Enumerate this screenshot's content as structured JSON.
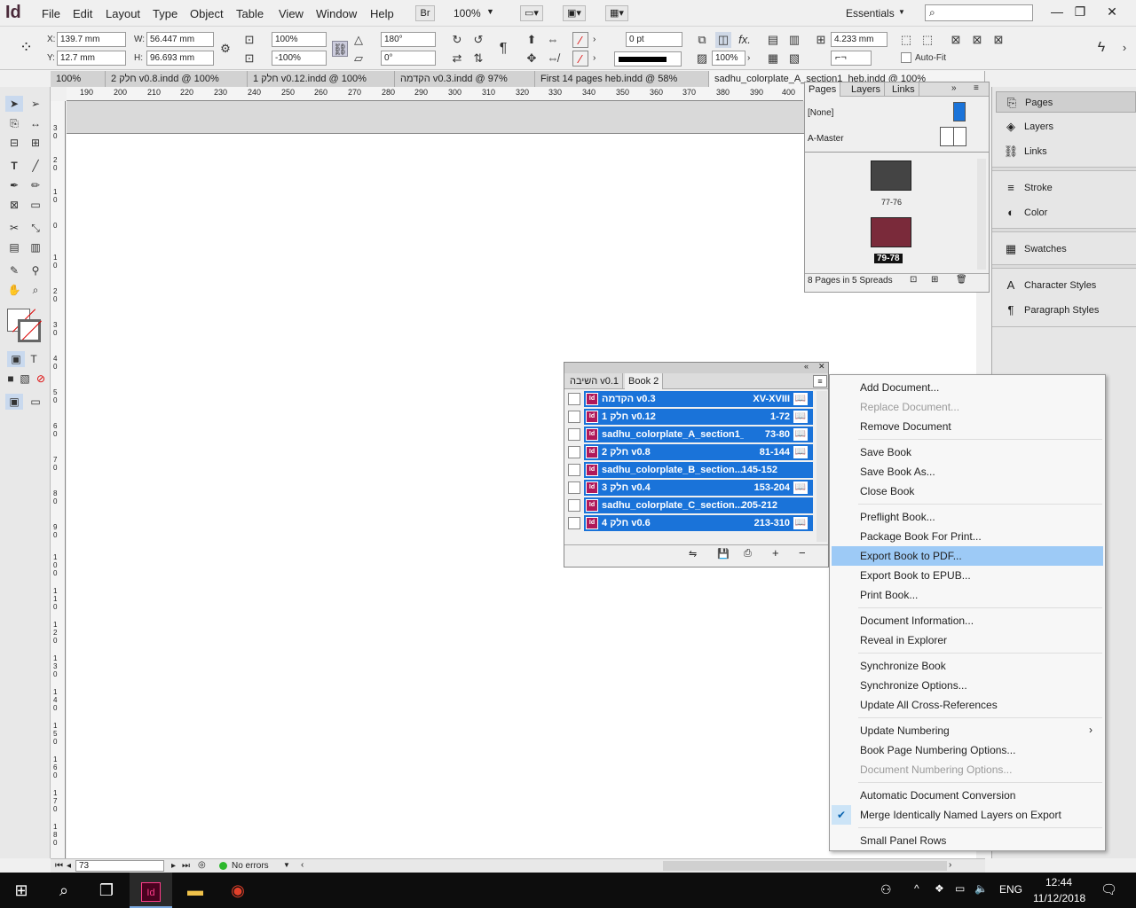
{
  "app": {
    "logo": "Id",
    "menus": [
      "File",
      "Edit",
      "Layout",
      "Type",
      "Object",
      "Table",
      "View",
      "Window",
      "Help"
    ],
    "bridge_label": "Br",
    "zoom": "100%",
    "workspace": "Essentials",
    "search_placeholder": ""
  },
  "control": {
    "x_label": "X:",
    "x_value": "139.7 mm",
    "y_label": "Y:",
    "y_value": "12.7 mm",
    "w_label": "W:",
    "w_value": "56.447 mm",
    "h_label": "H:",
    "h_value": "96.693 mm",
    "scale_x": "100%",
    "scale_y": "-100%",
    "rotate": "180°",
    "shear": "0°",
    "stroke_weight": "0 pt",
    "opacity": "100%",
    "dimension": "4.233 mm",
    "auto_fit": "Auto-Fit"
  },
  "tabs": [
    {
      "label": "100%"
    },
    {
      "label": "2 חלק v0.8.indd @ 100%"
    },
    {
      "label": "1 חלק v0.12.indd @ 100%"
    },
    {
      "label": "הקדמה v0.3.indd @ 97%"
    },
    {
      "label": "First 14 pages heb.indd @ 58%"
    },
    {
      "label": "sadhu_colorplate_A_section1_heb.indd @ 100%"
    }
  ],
  "ruler": {
    "h_ticks": [
      "190",
      "200",
      "210",
      "220",
      "230",
      "240",
      "250",
      "260",
      "270",
      "280",
      "290",
      "300",
      "310",
      "320",
      "330",
      "340",
      "350",
      "360",
      "370",
      "380",
      "390",
      "400"
    ],
    "v_ticks": [
      "3 0",
      "2 0",
      "1 0",
      "0",
      "1 0",
      "2 0",
      "3 0",
      "4 0",
      "5 0",
      "6 0",
      "7 0",
      "8 0",
      "9 0",
      "1 0 0",
      "1 1 0",
      "1 2 0",
      "1 3 0",
      "1 4 0",
      "1 5 0",
      "1 6 0",
      "1 7 0",
      "1 8 0"
    ]
  },
  "pages_panel": {
    "tabs": [
      "Pages",
      "Layers",
      "Links"
    ],
    "none_label": "[None]",
    "master_label": "A-Master",
    "spread1": "77-76",
    "spread2": "79-78",
    "status": "8 Pages in 5 Spreads"
  },
  "dock": {
    "items": [
      "Pages",
      "Layers",
      "Links",
      "Stroke",
      "Color",
      "Swatches",
      "Character Styles",
      "Paragraph Styles"
    ]
  },
  "book_panel": {
    "tab_inactive": "השיבה v0.1",
    "tab_active": "Book 2",
    "rows": [
      {
        "name": "הקדמה v0.3",
        "pages": "XV-XVIII"
      },
      {
        "name": "1 חלק v0.12",
        "pages": "1-72"
      },
      {
        "name": "sadhu_colorplate_A_section1_...",
        "pages": "73-80"
      },
      {
        "name": "2 חלק v0.8",
        "pages": "81-144"
      },
      {
        "name": "sadhu_colorplate_B_section...",
        "pages": "145-152"
      },
      {
        "name": "3 חלק v0.4",
        "pages": "153-204"
      },
      {
        "name": "sadhu_colorplate_C_section...",
        "pages": "205-212"
      },
      {
        "name": "4 חלק v0.6",
        "pages": "213-310"
      }
    ]
  },
  "menu": {
    "add_document": "Add Document...",
    "replace_document": "Replace Document...",
    "remove_document": "Remove Document",
    "save_book": "Save Book",
    "save_book_as": "Save Book As...",
    "close_book": "Close Book",
    "preflight_book": "Preflight Book...",
    "package_book": "Package Book For Print...",
    "export_pdf": "Export Book to PDF...",
    "export_epub": "Export Book to EPUB...",
    "print_book": "Print Book...",
    "document_information": "Document Information...",
    "reveal_explorer": "Reveal in Explorer",
    "synchronize_book": "Synchronize Book",
    "synchronize_options": "Synchronize Options...",
    "update_cross_refs": "Update All Cross-References",
    "update_numbering": "Update Numbering",
    "book_page_numbering": "Book Page Numbering Options...",
    "document_numbering": "Document Numbering Options...",
    "auto_doc_conversion": "Automatic Document Conversion",
    "merge_layers": "Merge Identically Named Layers on Export",
    "small_panel_rows": "Small Panel Rows"
  },
  "statusbar": {
    "page": "73",
    "errors": "No errors"
  },
  "taskbar": {
    "lang": "ENG",
    "time": "12:44",
    "date": "11/12/2018"
  }
}
